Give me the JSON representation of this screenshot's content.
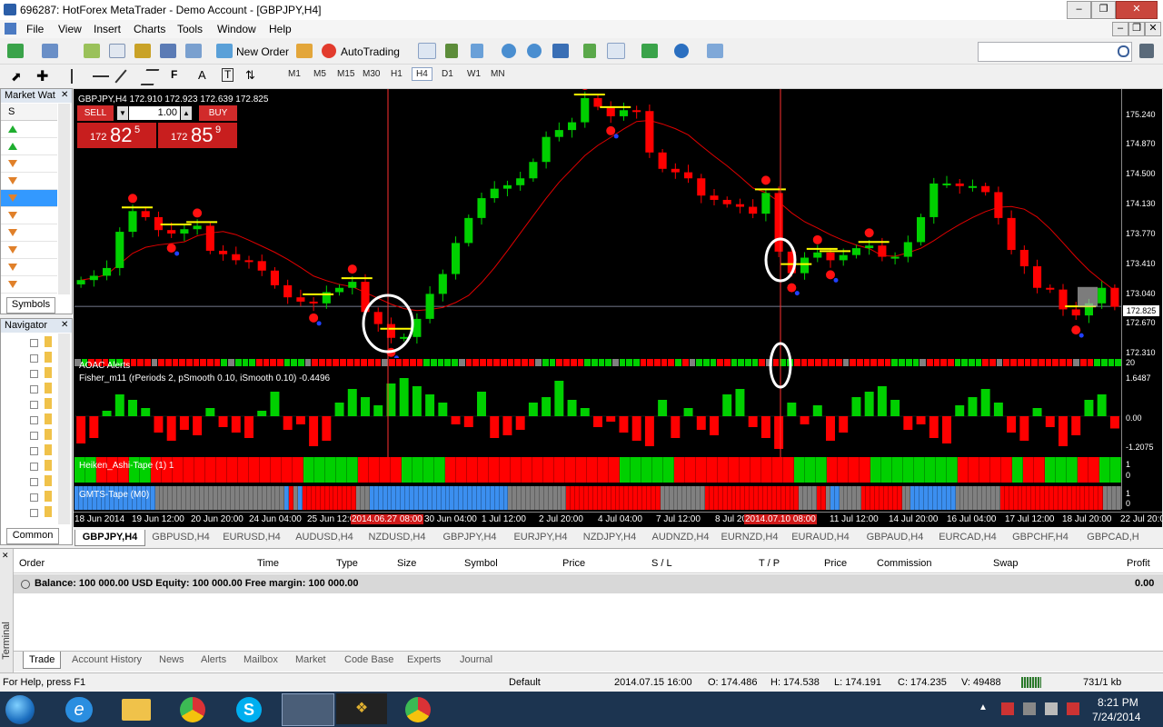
{
  "window": {
    "title": "696287: HotForex MetaTrader - Demo Account - [GBPJPY,H4]"
  },
  "menu": [
    "File",
    "View",
    "Insert",
    "Charts",
    "Tools",
    "Window",
    "Help"
  ],
  "toolbar": {
    "new_order": "New Order",
    "autotrading": "AutoTrading"
  },
  "timeframes": [
    "M1",
    "M5",
    "M15",
    "M30",
    "H1",
    "H4",
    "D1",
    "W1",
    "MN"
  ],
  "market_watch": {
    "title": "Market Wat",
    "col_symbol": "S",
    "tab": "Symbols",
    "rows": 10
  },
  "navigator": {
    "title": "Navigator",
    "tab": "Common"
  },
  "chart": {
    "header": "GBPJPY,H4  172.910 172.923 172.639 172.825",
    "trade": {
      "sell": "SELL",
      "buy": "BUY",
      "lots": "1.00",
      "bid_small": "172",
      "bid_big": "82",
      "bid_sup": "5",
      "ask_small": "172",
      "ask_big": "85",
      "ask_sup": "9"
    },
    "price_ticks": [
      "175.240",
      "174.870",
      "174.500",
      "174.130",
      "173.770",
      "173.410",
      "173.040",
      "172.670",
      "172.310"
    ],
    "current_price": "172.825",
    "aoac_label": "AOAC Alerts",
    "aoac_scale": "20",
    "fisher_label": "Fisher_m11  (rPeriods 2, pSmooth 0.10, iSmooth 0.10)  -0.4496",
    "fisher_ticks": [
      "1.6487",
      "0.00",
      "-1.2075"
    ],
    "heiken_label": "Heiken_Ashi-Tape (1) 1",
    "gmts_label": "GMTS-Tape (M0)",
    "tape_ticks": [
      "1",
      "0"
    ],
    "time_labels": [
      "18 Jun 2014",
      "19 Jun 12:00",
      "20 Jun 20:00",
      "24 Jun 04:00",
      "25 Jun 12:00",
      "2014.06.27 08:00",
      "30 Jun 04:00",
      "1 Jul 12:00",
      "2 Jul 20:00",
      "4 Jul 04:00",
      "7 Jul 12:00",
      "8 Jul 20:00",
      "2014.07.10 08:00",
      "11 Jul 12:00",
      "14 Jul 20:00",
      "16 Jul 04:00",
      "17 Jul 12:00",
      "18 Jul 20:00",
      "22 Jul 20:00"
    ],
    "colors": {
      "bull": "#00d000",
      "bear": "#ff0000",
      "ma": "#e00000",
      "level": "#ffff00",
      "gmts_blue": "#3b8ff0",
      "gray": "#808080"
    }
  },
  "chart_data": {
    "type": "candlestick",
    "symbol": "GBPJPY",
    "timeframe": "H4",
    "ylim": [
      172.31,
      175.24
    ],
    "close": [
      173.13,
      173.18,
      173.27,
      173.69,
      173.93,
      173.86,
      173.71,
      173.67,
      173.72,
      173.76,
      173.47,
      173.43,
      173.36,
      173.35,
      173.24,
      173.07,
      172.93,
      172.88,
      172.86,
      172.99,
      173.04,
      173.11,
      172.76,
      172.62,
      172.46,
      172.47,
      172.68,
      172.97,
      173.2,
      173.56,
      173.85,
      174.08,
      174.19,
      174.23,
      174.31,
      174.5,
      174.79,
      174.87,
      174.96,
      175.24,
      175.14,
      175.03,
      175.1,
      175.09,
      174.61,
      174.42,
      174.38,
      174.31,
      174.11,
      174.06,
      174.01,
      173.98,
      173.9,
      174.14,
      173.46,
      173.21,
      173.39,
      173.45,
      173.36,
      173.42,
      173.5,
      173.53,
      173.4,
      173.4,
      173.57,
      173.86,
      174.25,
      174.25,
      174.22,
      174.22,
      174.15,
      173.85,
      173.48,
      173.29,
      173.04,
      173.02,
      172.79,
      172.72,
      172.86,
      173.04,
      172.82
    ],
    "fisher": [
      -1.0,
      -0.8,
      0.2,
      0.8,
      0.6,
      0.3,
      -0.6,
      -0.9,
      -0.5,
      -0.7,
      0.3,
      -0.4,
      -0.6,
      -0.8,
      0.2,
      0.9,
      -0.5,
      -0.3,
      -1.1,
      -0.9,
      0.5,
      1.0,
      0.7,
      0.4,
      1.2,
      1.4,
      1.1,
      0.8,
      0.5,
      -0.3,
      -0.4,
      0.9,
      -0.8,
      -0.7,
      -0.5,
      0.5,
      0.7,
      1.3,
      0.6,
      0.3,
      -0.4,
      -0.2,
      -0.6,
      -0.9,
      -1.1,
      0.6,
      -0.8,
      0.3,
      -0.5,
      -0.7,
      0.8,
      1.0,
      -0.4,
      -0.8,
      -1.2,
      0.5,
      -0.3,
      0.4,
      -0.9,
      -0.6,
      0.7,
      0.9,
      1.1,
      0.6,
      -0.5,
      -0.3,
      -0.8,
      -1.0,
      0.4,
      0.7,
      1.0,
      0.5,
      -0.6,
      -0.9,
      0.3,
      -0.4,
      -1.1,
      -0.7,
      0.6,
      0.8,
      -0.45
    ],
    "heiken": "GGRRRGGRRRRRRRRRRRRRRGGGGGRRRRGGGGRRRRRRRRRRRRRRRRGGGGGRRRRRRRRRRRGGGRRRRGGGGGGGGRRRRRGRRGGGRRGG",
    "gmts": "BBBBBBBBBBBBBBBBBBXXXXXXXXXXXXXXXXXXXXXXXXXXXXXBRXBRRRRRRRRRRRRXXXBBBBBBBBBBBBBBBBBBBBBBBBBBBBBBBXXXXXXXXXXXXXRRRRRRRRRRRRRRRRRRRRRXXXXXXXXXXRRRRRRRRRRRRRRRRRRRRRXXXXRRXBBXXXXXRRRRRRRRRXXBBBBBBBBBBXXXXXXXXXXRRRRRRRRRRRRRRRRRRRRRRRXXXX"
  },
  "symbol_tabs": [
    "GBPJPY,H4",
    "GBPUSD,H4",
    "EURUSD,H4",
    "AUDUSD,H4",
    "NZDUSD,H4",
    "GBPJPY,H4",
    "EURJPY,H4",
    "NZDJPY,H4",
    "AUDNZD,H4",
    "EURNZD,H4",
    "EURAUD,H4",
    "GBPAUD,H4",
    "EURCAD,H4",
    "GBPCHF,H4",
    "GBPCAD,H"
  ],
  "terminal": {
    "side_label": "Terminal",
    "columns": [
      "Order",
      "Time",
      "Type",
      "Size",
      "Symbol",
      "Price",
      "S / L",
      "T / P",
      "Price",
      "Commission",
      "Swap",
      "Profit"
    ],
    "balance": "Balance: 100 000.00 USD  Equity: 100 000.00  Free margin: 100 000.00",
    "balance_profit": "0.00",
    "tabs": [
      "Trade",
      "Account History",
      "News",
      "Alerts",
      "Mailbox",
      "Market",
      "Code Base",
      "Experts",
      "Journal"
    ]
  },
  "status": {
    "help": "For Help, press F1",
    "profile": "Default",
    "datetime": "2014.07.15 16:00",
    "open": "O: 174.486",
    "high": "H: 174.538",
    "low": "L: 174.191",
    "close": "C: 174.235",
    "volume": "V: 49488",
    "traffic": "731/1 kb"
  },
  "taskbar": {
    "time": "8:21 PM",
    "date": "7/24/2014"
  }
}
